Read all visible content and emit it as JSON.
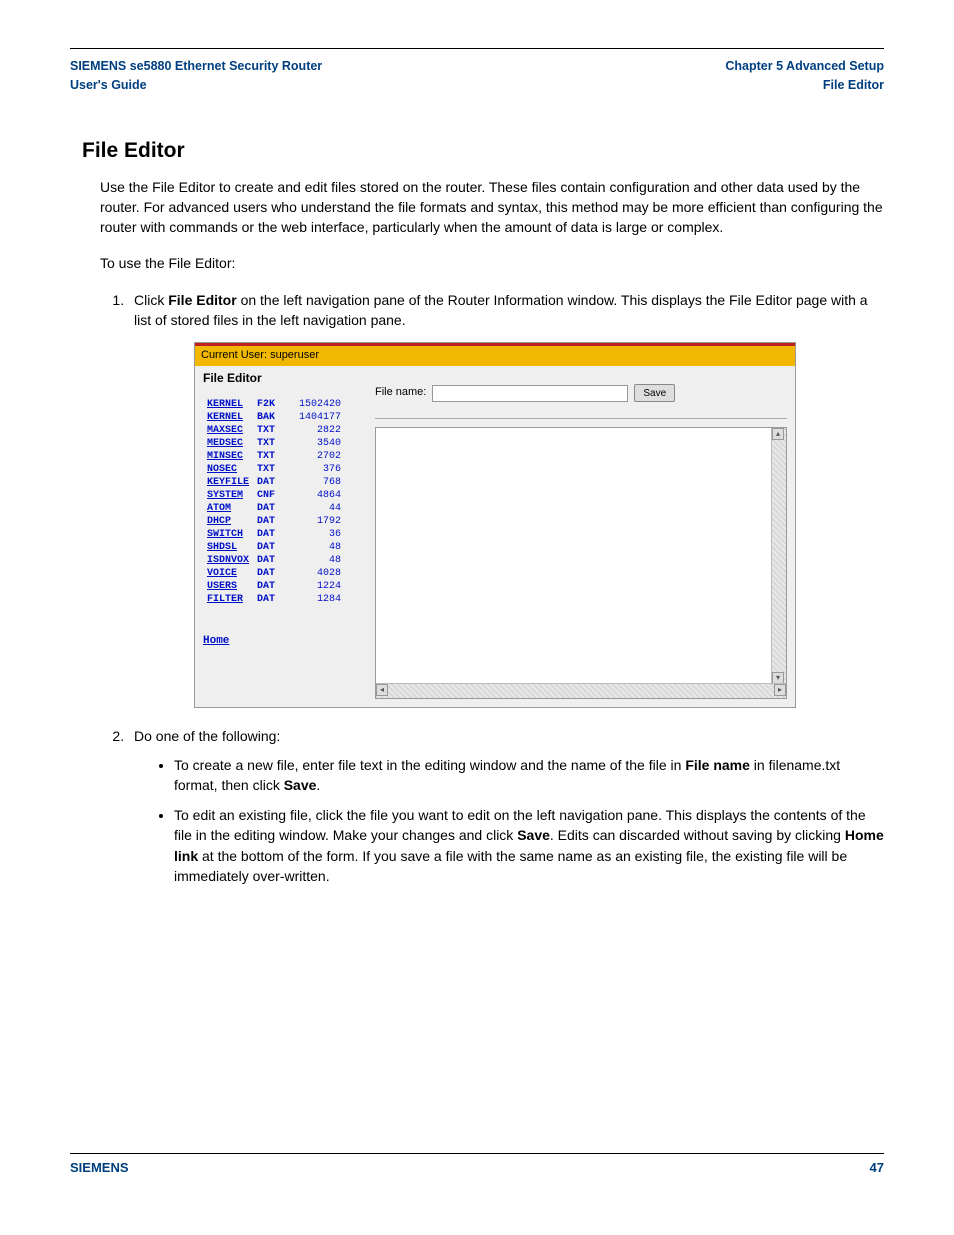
{
  "header": {
    "product": "SIEMENS se5880 Ethernet Security Router",
    "guide": "User's Guide",
    "chapter": "Chapter 5  Advanced Setup",
    "section_ref": "File Editor"
  },
  "section_title": "File Editor",
  "intro": "Use the File Editor to create and edit files stored on the router. These files contain configuration and other data used by the router. For advanced users who understand the file formats and syntax, this method may be more efficient than configuring the router with commands or the web interface, particularly when the amount of data is large or complex.",
  "lead_in": "To use the File Editor:",
  "step1_pre": "Click ",
  "step1_bold": "File Editor",
  "step1_post": " on the left navigation pane of the Router Information window. This displays the File Editor page with a list of stored files in the left navigation pane.",
  "screenshot": {
    "current_user_label": "Current User: superuser",
    "panel_title": "File Editor",
    "files": [
      {
        "name": "KERNEL",
        "ext": "F2K",
        "size": "1502420"
      },
      {
        "name": "KERNEL",
        "ext": "BAK",
        "size": "1404177"
      },
      {
        "name": "MAXSEC",
        "ext": "TXT",
        "size": "2822"
      },
      {
        "name": "MEDSEC",
        "ext": "TXT",
        "size": "3540"
      },
      {
        "name": "MINSEC",
        "ext": "TXT",
        "size": "2702"
      },
      {
        "name": "NOSEC",
        "ext": "TXT",
        "size": "376"
      },
      {
        "name": "KEYFILE",
        "ext": "DAT",
        "size": "768"
      },
      {
        "name": "SYSTEM",
        "ext": "CNF",
        "size": "4864"
      },
      {
        "name": "ATOM",
        "ext": "DAT",
        "size": "44"
      },
      {
        "name": "DHCP",
        "ext": "DAT",
        "size": "1792"
      },
      {
        "name": "SWITCH",
        "ext": "DAT",
        "size": "36"
      },
      {
        "name": "SHDSL",
        "ext": "DAT",
        "size": "48"
      },
      {
        "name": "ISDNVOX",
        "ext": "DAT",
        "size": "48"
      },
      {
        "name": "VOICE",
        "ext": "DAT",
        "size": "4028"
      },
      {
        "name": "USERS",
        "ext": "DAT",
        "size": "1224"
      },
      {
        "name": "FILTER",
        "ext": "DAT",
        "size": "1284"
      }
    ],
    "home_link": "Home",
    "filename_label": "File name:",
    "filename_value": "",
    "save_label": "Save"
  },
  "step2_intro": "Do one of the following:",
  "bullet1_pre": "To create a new file, enter file text in the editing window and the name of the file in ",
  "bullet1_b1": "File name",
  "bullet1_mid": " in filename.txt format, then click ",
  "bullet1_b2": "Save",
  "bullet1_post": ".",
  "bullet2_pre": "To edit an existing file, click the file you want to edit on the left navigation pane. This displays the contents of the file in the editing window. Make your changes and click ",
  "bullet2_b1": "Save",
  "bullet2_mid1": ". Edits can discarded without saving by clicking ",
  "bullet2_b2": "Home link",
  "bullet2_post": " at the bottom of the form. If you save a file with the same name as an existing file, the existing file will be immediately over-written.",
  "footer": {
    "brand": "SIEMENS",
    "page": "47"
  }
}
